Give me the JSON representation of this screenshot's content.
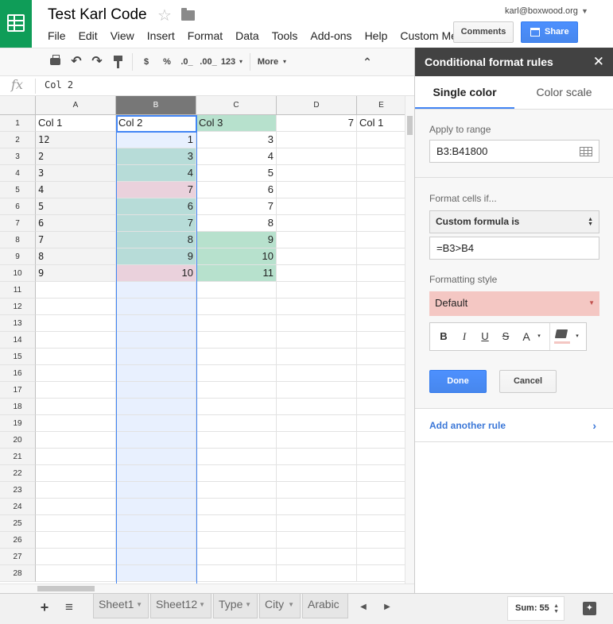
{
  "doc": {
    "title": "Test Karl Code",
    "account": "karl@boxwood.org"
  },
  "menu": [
    "File",
    "Edit",
    "View",
    "Insert",
    "Format",
    "Data",
    "Tools",
    "Add-ons",
    "Help",
    "Custom Menu"
  ],
  "header": {
    "comments_label": "Comments",
    "share_label": "Share"
  },
  "toolbar": {
    "currency": "$",
    "percent": "%",
    "dec_decrease": ".0_",
    "dec_increase": ".00_",
    "number_format": "123",
    "more": "More",
    "caret": "▾",
    "collapse": "⌃"
  },
  "formula_bar": {
    "fx": "fx",
    "content": "Col 2"
  },
  "grid": {
    "columns": [
      "A",
      "B",
      "C",
      "D",
      "E"
    ],
    "rows": [
      "1",
      "2",
      "3",
      "4",
      "5",
      "6",
      "7",
      "8",
      "9",
      "10",
      "11",
      "12",
      "13",
      "14",
      "15",
      "16",
      "17",
      "18",
      "19",
      "20",
      "21",
      "22",
      "23",
      "24",
      "25",
      "26",
      "27",
      "28"
    ],
    "cells": [
      [
        "Col 1",
        "Col 2",
        "Col 3",
        "7",
        "Col 1"
      ],
      [
        "12",
        "1",
        "3",
        "",
        ""
      ],
      [
        "2",
        "3",
        "4",
        "",
        ""
      ],
      [
        "3",
        "4",
        "5",
        "",
        ""
      ],
      [
        "4",
        "7",
        "6",
        "",
        ""
      ],
      [
        "5",
        "6",
        "7",
        "",
        ""
      ],
      [
        "6",
        "7",
        "8",
        "",
        ""
      ],
      [
        "7",
        "8",
        "9",
        "",
        ""
      ],
      [
        "8",
        "9",
        "10",
        "",
        ""
      ],
      [
        "9",
        "10",
        "11",
        "",
        ""
      ]
    ]
  },
  "colors": {
    "sheets_green": "#0f9d58",
    "teal_fill": "#b7dcd8",
    "green_fill": "#b7e1cd",
    "pink_fill": "#ead1dc",
    "selection_fill": "#e8f0fe",
    "selection_border": "#4285f4",
    "rule_preview": "#f4c7c3"
  },
  "sheets": {
    "add_icon": "+",
    "list_icon": "≡",
    "tabs": [
      "Sheet1",
      "Sheet12",
      "Type",
      "City",
      "Arabic"
    ],
    "prev": "◀",
    "next": "▶",
    "sum_label": "Sum: 55",
    "explore_icon": "✦"
  },
  "panel": {
    "title": "Conditional format rules",
    "close": "✕",
    "tabs": [
      "Single color",
      "Color scale"
    ],
    "apply_label": "Apply to range",
    "range": "B3:B41800",
    "format_if_label": "Format cells if...",
    "condition": "Custom formula is",
    "formula": "=B3>B4",
    "style_label": "Formatting style",
    "style_value": "Default",
    "fmt_buttons": {
      "bold": "B",
      "italic": "I",
      "underline": "U",
      "strike": "S",
      "text_color": "A",
      "caret": "▾"
    },
    "done": "Done",
    "cancel": "Cancel",
    "add_rule": "Add another rule",
    "chevron": "›"
  }
}
